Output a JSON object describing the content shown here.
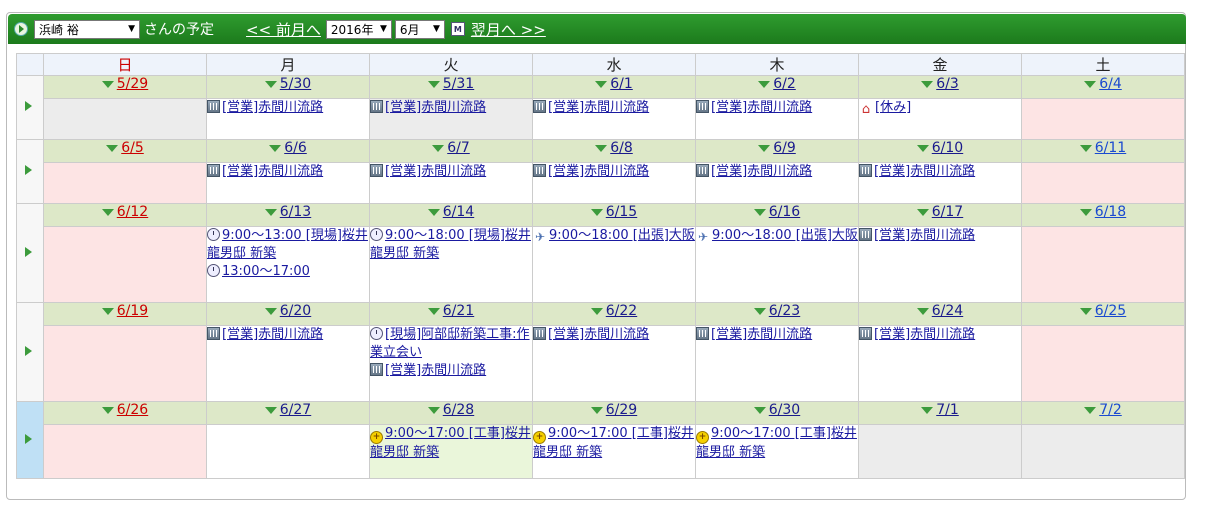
{
  "header": {
    "user_name": "浜崎 裕",
    "suffix": "さんの予定",
    "prev_label": "<< 前月へ",
    "year": "2016年",
    "month": "6月",
    "calendar_icon": "M",
    "next_label": "翌月へ >>"
  },
  "weekdays": [
    "日",
    "月",
    "火",
    "水",
    "木",
    "金",
    "土"
  ],
  "weeks": [
    {
      "dates": [
        "5/29",
        "5/30",
        "5/31",
        "6/1",
        "6/2",
        "6/3",
        "6/4"
      ],
      "bg": [
        "grey",
        "white",
        "grey",
        "white",
        "white",
        "white",
        "pink"
      ],
      "events": [
        [],
        [
          {
            "icon": "building-icon",
            "text": "[営業]赤間川流路"
          }
        ],
        [
          {
            "icon": "building-icon",
            "text": "[営業]赤間川流路"
          }
        ],
        [
          {
            "icon": "building-icon",
            "text": "[営業]赤間川流路"
          }
        ],
        [
          {
            "icon": "building-icon",
            "text": "[営業]赤間川流路"
          }
        ],
        [
          {
            "icon": "home-icon",
            "text": "[休み]"
          }
        ],
        []
      ]
    },
    {
      "dates": [
        "6/5",
        "6/6",
        "6/7",
        "6/8",
        "6/9",
        "6/10",
        "6/11"
      ],
      "bg": [
        "pink",
        "white",
        "white",
        "white",
        "white",
        "white",
        "pink"
      ],
      "events": [
        [],
        [
          {
            "icon": "building-icon",
            "text": "[営業]赤間川流路"
          }
        ],
        [
          {
            "icon": "building-icon",
            "text": "[営業]赤間川流路"
          }
        ],
        [
          {
            "icon": "building-icon",
            "text": "[営業]赤間川流路"
          }
        ],
        [
          {
            "icon": "building-icon",
            "text": "[営業]赤間川流路"
          }
        ],
        [
          {
            "icon": "building-icon",
            "text": "[営業]赤間川流路"
          }
        ],
        []
      ]
    },
    {
      "dates": [
        "6/12",
        "6/13",
        "6/14",
        "6/15",
        "6/16",
        "6/17",
        "6/18"
      ],
      "bg": [
        "pink",
        "white",
        "white",
        "white",
        "white",
        "white",
        "pink"
      ],
      "events": [
        [],
        [
          {
            "icon": "clock-icon",
            "text": "9:00～13:00 [現場]桜井龍男邸 新築"
          },
          {
            "icon": "clock-icon",
            "text": "13:00～17:00"
          }
        ],
        [
          {
            "icon": "clock-icon",
            "text": "9:00～18:00 [現場]桜井龍男邸 新築"
          }
        ],
        [
          {
            "icon": "airplane-icon",
            "text": "9:00～18:00 [出張]大阪"
          }
        ],
        [
          {
            "icon": "airplane-icon",
            "text": "9:00～18:00 [出張]大阪"
          }
        ],
        [
          {
            "icon": "building-icon",
            "text": "[営業]赤間川流路"
          }
        ],
        []
      ]
    },
    {
      "dates": [
        "6/19",
        "6/20",
        "6/21",
        "6/22",
        "6/23",
        "6/24",
        "6/25"
      ],
      "bg": [
        "pink",
        "white",
        "white",
        "white",
        "white",
        "white",
        "pink"
      ],
      "events": [
        [],
        [
          {
            "icon": "building-icon",
            "text": "[営業]赤間川流路"
          }
        ],
        [
          {
            "icon": "clock-icon",
            "text": "[現場]阿部邸新築工事:作業立会い"
          },
          {
            "icon": "building-icon",
            "text": "[営業]赤間川流路"
          }
        ],
        [
          {
            "icon": "building-icon",
            "text": "[営業]赤間川流路"
          }
        ],
        [
          {
            "icon": "building-icon",
            "text": "[営業]赤間川流路"
          }
        ],
        [
          {
            "icon": "building-icon",
            "text": "[営業]赤間川流路"
          }
        ],
        []
      ]
    },
    {
      "dates": [
        "6/26",
        "6/27",
        "6/28",
        "6/29",
        "6/30",
        "7/1",
        "7/2"
      ],
      "bg": [
        "pink",
        "white",
        "green",
        "white",
        "white",
        "grey",
        "grey"
      ],
      "events": [
        [],
        [],
        [
          {
            "icon": "construction-icon",
            "text": "9:00～17:00 [工事]桜井龍男邸 新築"
          }
        ],
        [
          {
            "icon": "construction-icon",
            "text": "9:00～17:00 [工事]桜井龍男邸 新築"
          }
        ],
        [
          {
            "icon": "construction-icon",
            "text": "9:00～17:00 [工事]桜井龍男邸 新築"
          }
        ],
        [],
        []
      ]
    }
  ]
}
